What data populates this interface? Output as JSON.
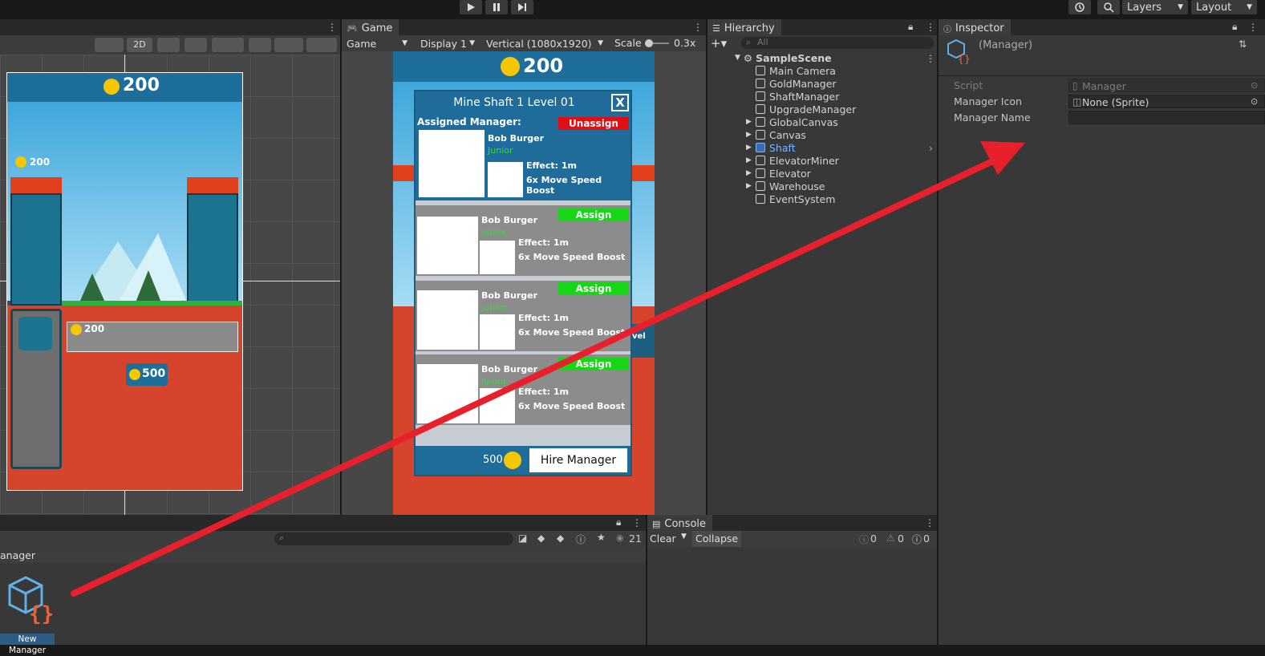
{
  "toolbar": {
    "layers_label": "Layers",
    "layout_label": "Layout"
  },
  "scene": {
    "mode_2d": "2D",
    "coin_top": "200",
    "coin_left": "200",
    "coin_mid": "200",
    "coin_cost": "500",
    "level_label": "Level"
  },
  "game": {
    "tab_label": "Game",
    "game_dropdown": "Game",
    "display_dropdown": "Display 1",
    "resolution_dropdown": "Vertical (1080x1920)",
    "scale_label": "Scale",
    "scale_value": "0.3x",
    "coins": "200",
    "dialog_title": "Mine Shaft 1 Level 01",
    "close_label": "X",
    "assigned_label": "Assigned Manager:",
    "unassign_label": "Unassign",
    "assign_label": "Assign",
    "managers": [
      {
        "name": "Bob Burger",
        "rank": "Junior",
        "effect": "Effect: 1m",
        "boost": "6x Move Speed Boost"
      },
      {
        "name": "Bob Burger",
        "rank": "Junior",
        "effect": "Effect: 1m",
        "boost": "6x Move Speed Boost"
      },
      {
        "name": "Bob Burger",
        "rank": "Junior",
        "effect": "Effect: 1m",
        "boost": "6x Move Speed Boost"
      },
      {
        "name": "Bob Burger",
        "rank": "Junior",
        "effect": "Effect: 1m",
        "boost": "6x Move Speed Boost"
      }
    ],
    "hire_cost": "500",
    "hire_label": "Hire Manager",
    "side_level": "vel"
  },
  "hierarchy": {
    "tab_label": "Hierarchy",
    "search_placeholder": "All",
    "scene_name": "SampleScene",
    "items": [
      {
        "label": "Main Camera",
        "expandable": false
      },
      {
        "label": "GoldManager",
        "expandable": false
      },
      {
        "label": "ShaftManager",
        "expandable": false
      },
      {
        "label": "UpgradeManager",
        "expandable": false
      },
      {
        "label": "GlobalCanvas",
        "expandable": true
      },
      {
        "label": "Canvas",
        "expandable": true
      },
      {
        "label": "Shaft",
        "expandable": true
      },
      {
        "label": "ElevatorMiner",
        "expandable": true
      },
      {
        "label": "Elevator",
        "expandable": true
      },
      {
        "label": "Warehouse",
        "expandable": true
      },
      {
        "label": "EventSystem",
        "expandable": false
      }
    ]
  },
  "inspector": {
    "tab_label": "Inspector",
    "object_name": "(Manager)",
    "fields": [
      {
        "label": "Script",
        "value": "Manager"
      },
      {
        "label": "Manager Icon",
        "value": "None (Sprite)"
      },
      {
        "label": "Manager Name",
        "value": ""
      }
    ]
  },
  "project": {
    "breadcrumb": "anager",
    "visible_count": "21",
    "asset_label": "New Manager"
  },
  "console": {
    "tab_label": "Console",
    "clear_label": "Clear",
    "collapse_label": "Collapse",
    "log_count": "0",
    "warn_count": "0",
    "error_count": "0"
  },
  "colors": {
    "accent_red_arrow": "#e8202c",
    "unassign_red": "#e00f14",
    "assign_green": "#16d616",
    "dialog_blue": "#1f6c9a",
    "selected_blue": "#3d6ab2",
    "shaft_highlight": "#7ab4ff"
  }
}
